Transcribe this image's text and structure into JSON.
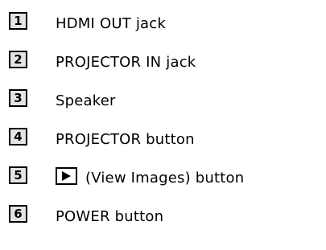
{
  "items": [
    {
      "number": "1",
      "label": "HDMI OUT jack"
    },
    {
      "number": "2",
      "label": "PROJECTOR IN jack"
    },
    {
      "number": "3",
      "label": "Speaker"
    },
    {
      "number": "4",
      "label": "PROJECTOR button"
    },
    {
      "number": "5",
      "icon": "play-icon",
      "label": "(View Images) button"
    },
    {
      "number": "6",
      "label": "POWER button"
    }
  ]
}
